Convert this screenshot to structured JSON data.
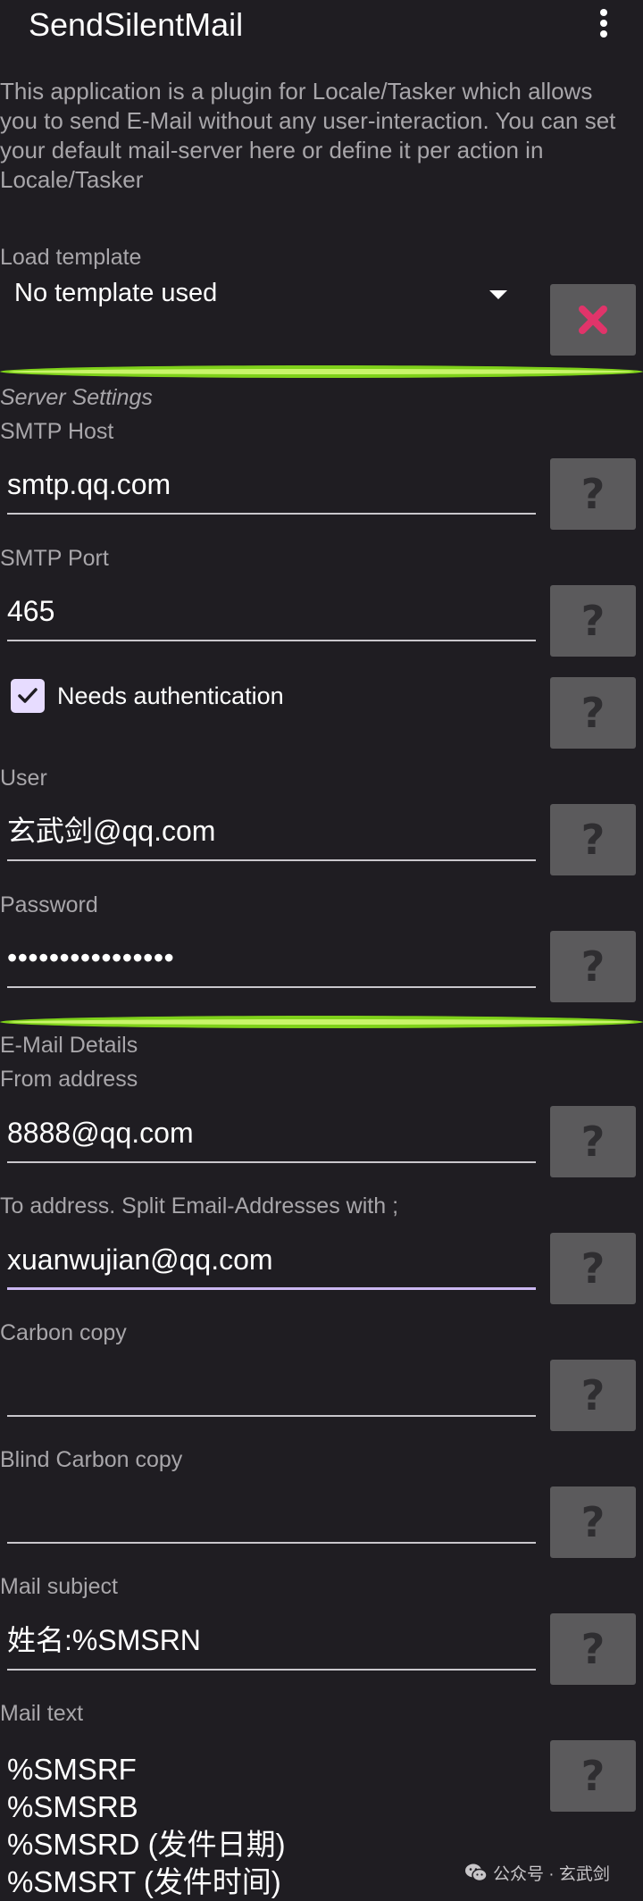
{
  "app": {
    "title": "SendSilentMail"
  },
  "description": "This application is a plugin for Locale/Tasker which allows you to send E-Mail without any user-interaction. You can set your default mail-server here or define it per action in Locale/Tasker",
  "template": {
    "label": "Load template",
    "selected": "No template used"
  },
  "server": {
    "section_title": "Server Settings",
    "smtp_host_label": "SMTP Host",
    "smtp_host_value": "smtp.qq.com",
    "smtp_port_label": "SMTP Port",
    "smtp_port_value": "465",
    "auth_label": "Needs authentication",
    "auth_checked": true,
    "user_label": "User",
    "user_value": "玄武剑@qq.com",
    "password_label": "Password",
    "password_value": "••••••••••••••••"
  },
  "mail": {
    "section_title": "E-Mail Details",
    "from_label": "From address",
    "from_value": "8888@qq.com",
    "to_label": "To address. Split Email-Addresses with ;",
    "to_value": "xuanwujian@qq.com",
    "cc_label": "Carbon copy",
    "cc_value": "",
    "bcc_label": "Blind Carbon copy",
    "bcc_value": "",
    "subject_label": "Mail subject",
    "subject_value": "姓名:%SMSRN",
    "text_label": "Mail text",
    "text_lines": [
      "%SMSRF",
      "%SMSRB",
      "%SMSRD (发件日期)",
      "%SMSRT (发件时间)"
    ]
  },
  "help_button_label": "?",
  "watermark": "公众号 · 玄武剑",
  "colors": {
    "background": "#1f1d22",
    "accent_divider": "#7fd11a",
    "help_button": "#5b5a5c",
    "clear_icon": "#e0346a",
    "focus_underline": "#cbb7f1",
    "checkbox": "#e7dcff"
  },
  "icons": {
    "menu": "overflow-menu-icon",
    "dropdown": "dropdown-arrow-icon",
    "clear": "clear-x-icon",
    "help": "help-question-icon",
    "checkbox": "checkmark-icon",
    "watermark": "wechat-icon"
  }
}
